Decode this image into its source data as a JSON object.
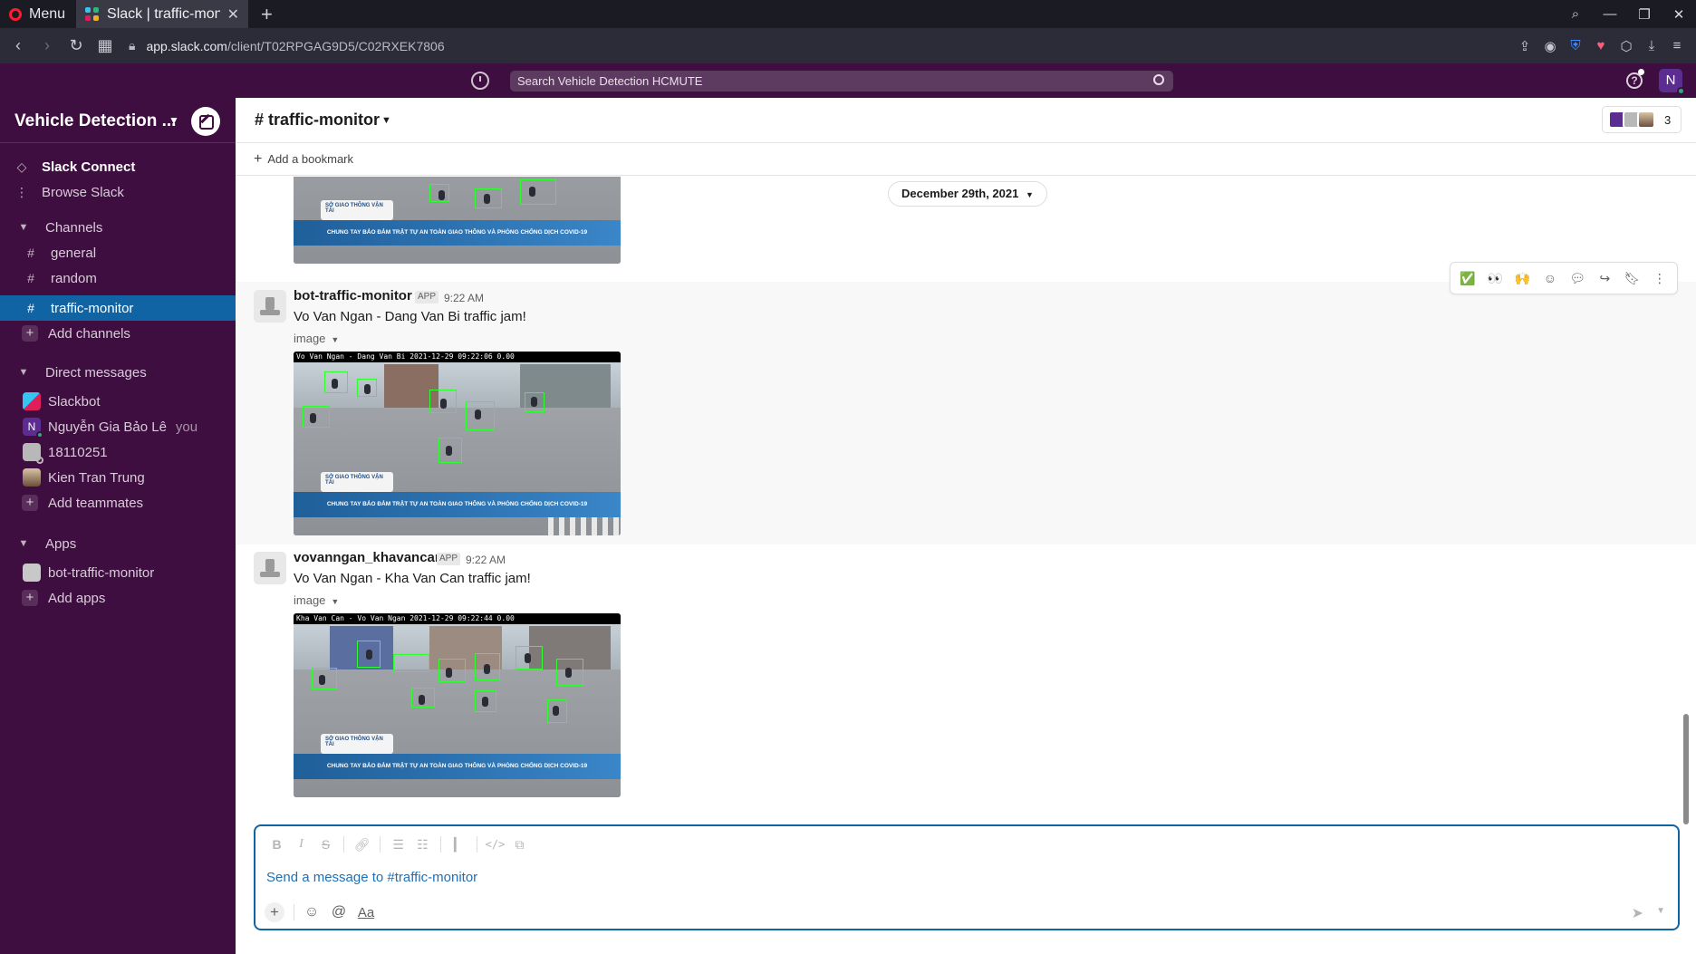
{
  "browser": {
    "menu_label": "Menu",
    "tab_title": "Slack | traffic-monito",
    "url_domain": "app.slack.com",
    "url_path": "/client/T02RPGAG9D5/C02RXEK7806"
  },
  "topbar": {
    "search_placeholder": "Search Vehicle Detection HCMUTE",
    "user_initial": "N"
  },
  "sidebar": {
    "workspace_name": "Vehicle Detection ...",
    "nav": [
      {
        "label": "Slack Connect"
      },
      {
        "label": "Browse Slack"
      }
    ],
    "channels_header": "Channels",
    "channels": [
      "general",
      "random",
      "traffic-monitor"
    ],
    "active_channel": "traffic-monitor",
    "add_channels": "Add channels",
    "dm_header": "Direct messages",
    "dms": [
      {
        "name": "Slackbot"
      },
      {
        "name": "Nguyễn Gia Bảo Lê",
        "suffix": "you"
      },
      {
        "name": "18110251"
      },
      {
        "name": "Kien Tran Trung"
      }
    ],
    "add_teammates": "Add teammates",
    "apps_header": "Apps",
    "apps": [
      "bot-traffic-monitor"
    ],
    "add_apps": "Add apps"
  },
  "channel": {
    "name": "# traffic-monitor",
    "member_count": "3",
    "add_bookmark": "Add a bookmark",
    "date_divider": "December 29th, 2021"
  },
  "messages": [
    {
      "sender": "bot-traffic-monitor",
      "badge": "APP",
      "time": "9:22 AM",
      "text": "Vo Van Ngan - Dang Van Bi traffic jam!",
      "attachment_label": "image",
      "image_caption": "Vo Van Ngan - Dang Van Bi  2021-12-29 09:22:06  0.00"
    },
    {
      "sender": "vovanngan_khavancan",
      "badge": "APP",
      "time": "9:22 AM",
      "text": "Vo Van Ngan - Kha Van Can traffic jam!",
      "attachment_label": "image",
      "image_caption": "Kha Van Can - Vo Van Ngan 2021-12-29 09:22:44  0.00"
    }
  ],
  "image_banner": "CHUNG TAY BẢO ĐẢM TRẬT TỰ AN TOÀN GIAO THÔNG VÀ PHÒNG CHỐNG DỊCH COVID-19",
  "image_sign": "SỞ GIAO THÔNG VẬN TẢI",
  "composer": {
    "placeholder": "Send a message to #traffic-monitor",
    "text_style_label": "Aa"
  },
  "colors": {
    "sidebar_bg": "#3f0e40",
    "active_item": "#1164a3",
    "detection_box": "#2dff2d"
  }
}
